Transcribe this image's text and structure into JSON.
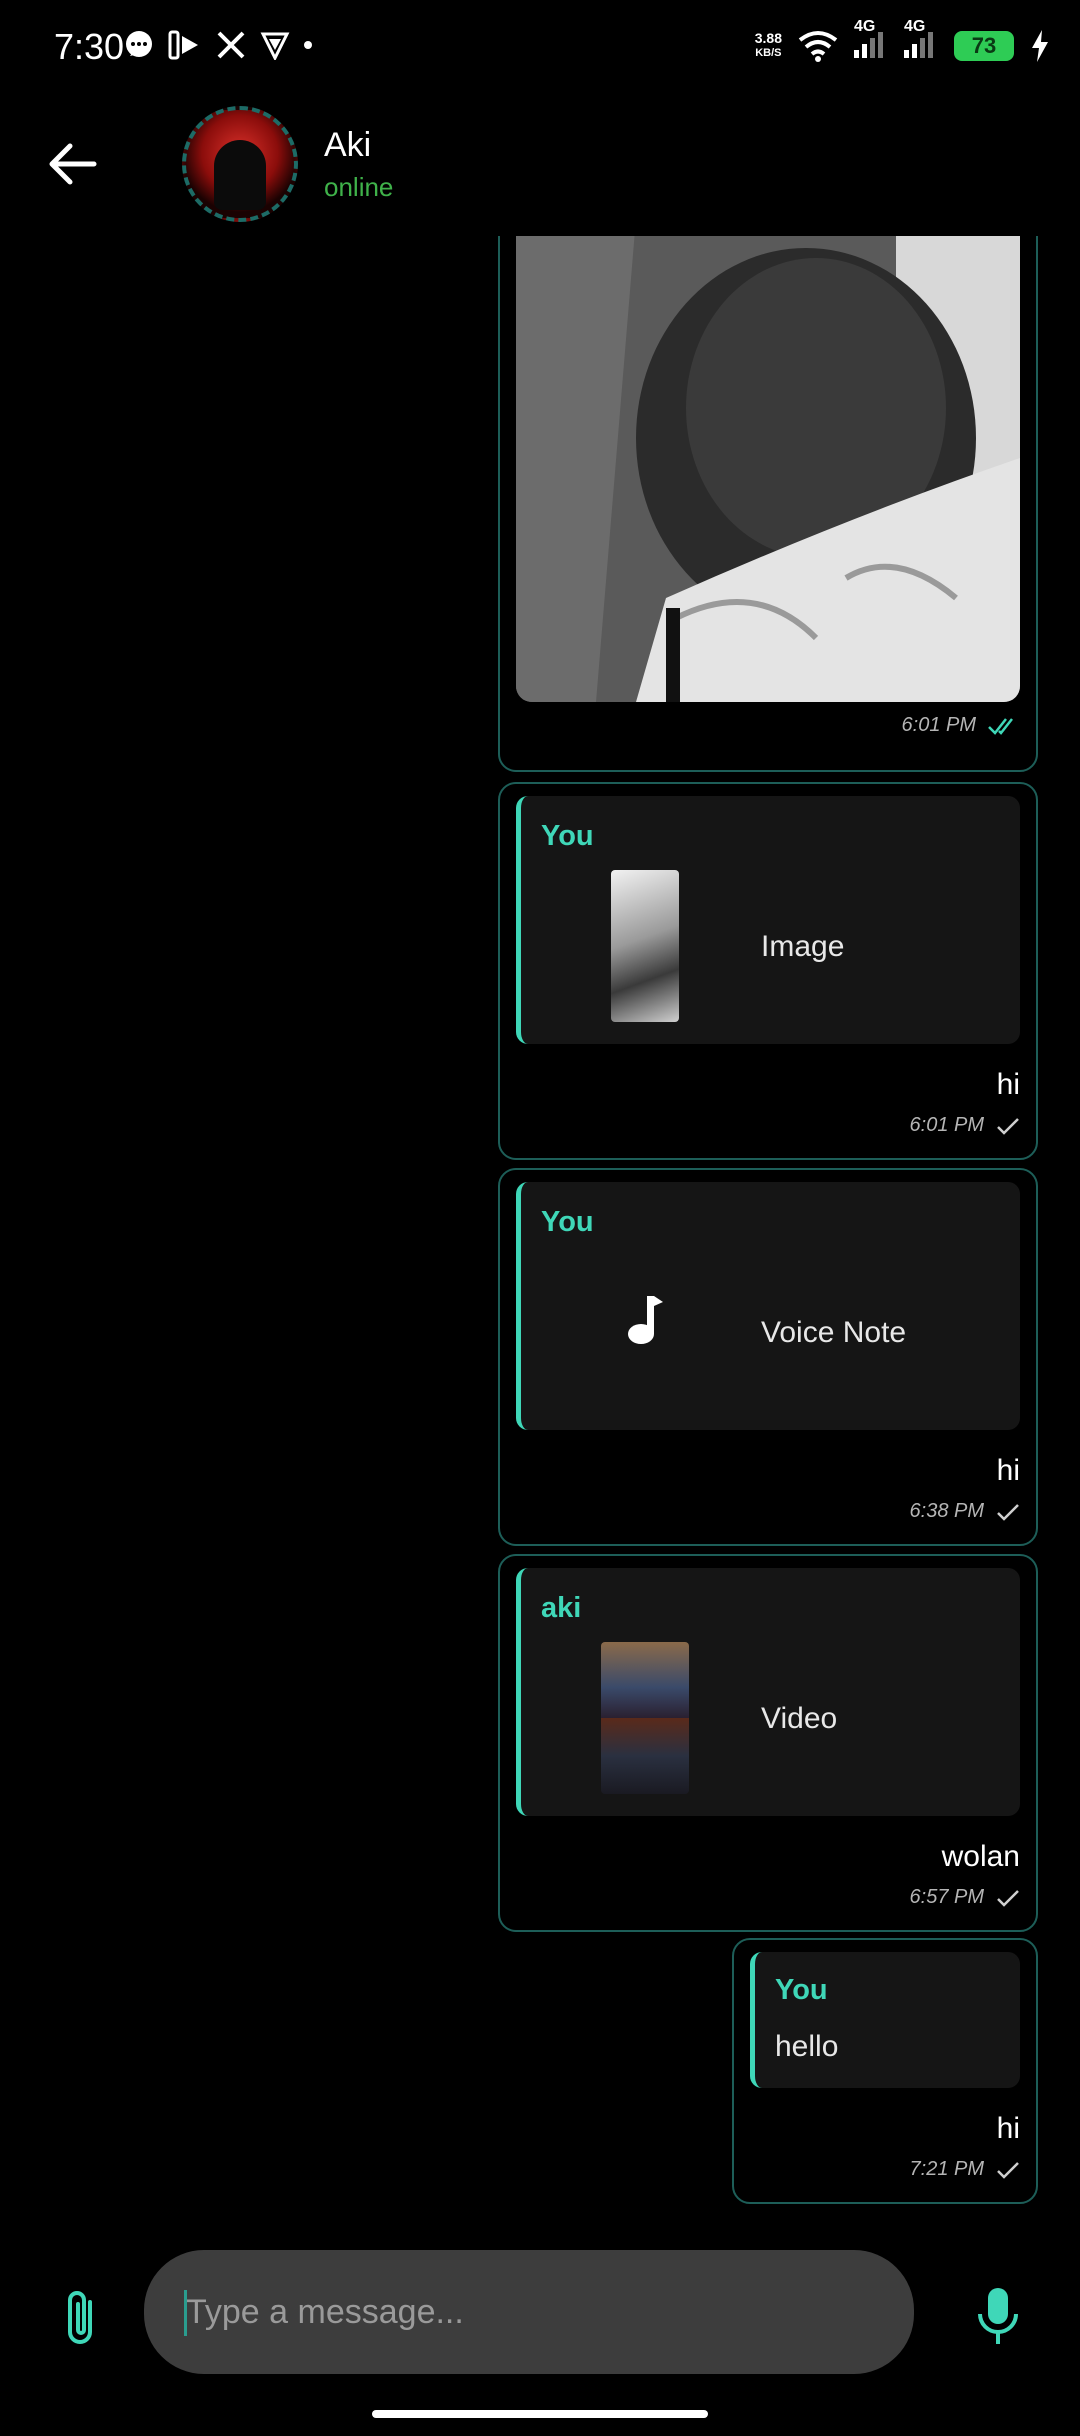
{
  "status_bar": {
    "time": "7:30",
    "net_speed_value": "3.88",
    "net_speed_unit": "KB/S",
    "network_1": "4G",
    "network_2": "4G",
    "battery": "73"
  },
  "header": {
    "contact_name": "Aki",
    "contact_status": "online"
  },
  "messages": [
    {
      "type": "image",
      "time": "6:01 PM",
      "status": "read"
    },
    {
      "type": "reply",
      "reply_sender": "You",
      "reply_kind": "Image",
      "text": "hi",
      "time": "6:01 PM",
      "status": "sent"
    },
    {
      "type": "reply",
      "reply_sender": "You",
      "reply_kind": "Voice Note",
      "text": "hi",
      "time": "6:38 PM",
      "status": "sent"
    },
    {
      "type": "reply",
      "reply_sender": "aki",
      "reply_kind": "Video",
      "text": "wolan",
      "time": "6:57 PM",
      "status": "sent"
    },
    {
      "type": "reply",
      "reply_sender": "You",
      "reply_text": "hello",
      "text": "hi",
      "time": "7:21 PM",
      "status": "sent"
    }
  ],
  "composer": {
    "placeholder": "Type a message..."
  },
  "colors": {
    "accent": "#3fd7b8",
    "online": "#3fb24a",
    "bubble_border": "#1d5e58",
    "battery": "#2ecc55"
  },
  "icons": [
    "back-arrow-icon",
    "attach-icon",
    "mic-icon",
    "music-note-icon",
    "double-check-icon",
    "check-icon",
    "wifi-icon",
    "signal-icon",
    "battery-icon",
    "charging-icon"
  ]
}
